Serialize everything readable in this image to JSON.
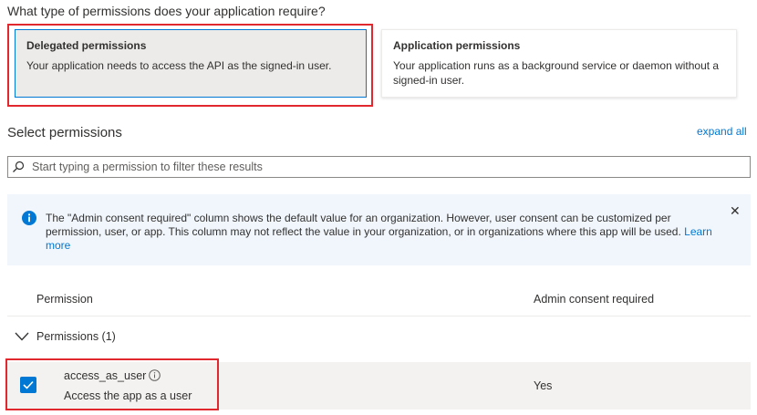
{
  "question": "What type of permissions does your application require?",
  "permission_types": [
    {
      "title": "Delegated permissions",
      "description": "Your application needs to access the API as the signed-in user.",
      "selected": true
    },
    {
      "title": "Application permissions",
      "description": "Your application runs as a background service or daemon without a signed-in user.",
      "selected": false
    }
  ],
  "select_permissions": {
    "title": "Select permissions",
    "expand_all": "expand all",
    "search_placeholder": "Start typing a permission to filter these results"
  },
  "info_banner": {
    "text": "The \"Admin consent required\" column shows the default value for an organization. However, user consent can be customized per permission, user, or app. This column may not reflect the value in your organization, or in organizations where this app will be used.",
    "link": "Learn more",
    "close_icon": "close-icon",
    "info_icon": "info-icon"
  },
  "table": {
    "columns": [
      "Permission",
      "Admin consent required"
    ],
    "groups": [
      {
        "label": "Permissions (1)",
        "expanded": true,
        "items": [
          {
            "name": "access_as_user",
            "description": "Access the app as a user",
            "admin_consent": "Yes",
            "checked": true
          }
        ]
      }
    ]
  },
  "colors": {
    "accent": "#0078d4",
    "highlight_border": "#e0282e",
    "info_bg": "#f0f6fc"
  }
}
